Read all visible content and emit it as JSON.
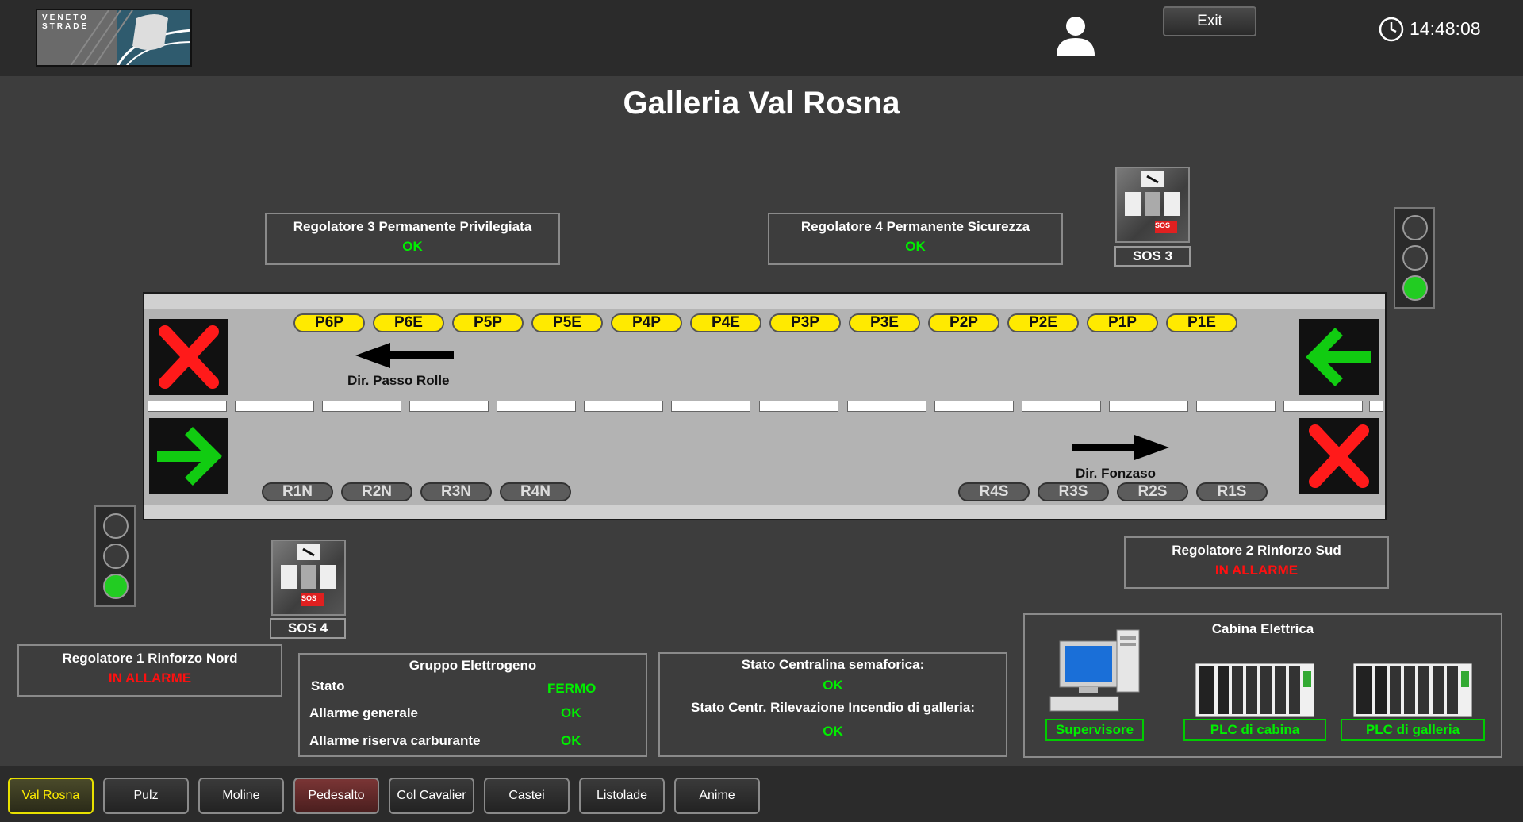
{
  "header": {
    "logo_text": "VENETO STRADE",
    "exit_label": "Exit",
    "time": "14:48:08"
  },
  "title": "Galleria Val Rosna",
  "regulators": {
    "r3": {
      "label": "Regolatore 3 Permanente Privilegiata",
      "status": "OK"
    },
    "r4": {
      "label": "Regolatore 4 Permanente Sicurezza",
      "status": "OK"
    },
    "r2": {
      "label": "Regolatore 2 Rinforzo Sud",
      "status": "IN ALLARME"
    },
    "r1": {
      "label": "Regolatore 1 Rinforzo Nord",
      "status": "IN ALLARME"
    }
  },
  "sos": {
    "sos3": "SOS 3",
    "sos4": "SOS 4",
    "badge": "SOS"
  },
  "tunnel": {
    "top_pills": [
      "P6P",
      "P6E",
      "P5P",
      "P5E",
      "P4P",
      "P4E",
      "P3P",
      "P3E",
      "P2P",
      "P2E",
      "P1P",
      "P1E"
    ],
    "bottom_left_pills": [
      "R1N",
      "R2N",
      "R3N",
      "R4N"
    ],
    "bottom_right_pills": [
      "R4S",
      "R3S",
      "R2S",
      "R1S"
    ],
    "dir_west": "Dir. Passo Rolle",
    "dir_east": "Dir. Fonzaso",
    "signals": {
      "top_left": "red-x",
      "top_right": "green-arrow-left",
      "bottom_left": "green-arrow-right",
      "bottom_right": "red-x"
    }
  },
  "traffic_lights": {
    "right": {
      "active_lamp": 3
    },
    "left": {
      "active_lamp": 3
    }
  },
  "generator": {
    "title": "Gruppo Elettrogeno",
    "rows": [
      {
        "label": "Stato",
        "value": "FERMO"
      },
      {
        "label": "Allarme generale",
        "value": "OK"
      },
      {
        "label": "Allarme riserva carburante",
        "value": "OK"
      }
    ]
  },
  "central": {
    "semaforica_label": "Stato Centralina semaforica:",
    "semaforica_value": "OK",
    "incendio_label": "Stato Centr. Rilevazione Incendio di galleria:",
    "incendio_value": "OK"
  },
  "cabina": {
    "title": "Cabina Elettrica",
    "supervisor": "Supervisore",
    "plc_cabina": "PLC di cabina",
    "plc_galleria": "PLC di galleria"
  },
  "nav": [
    "Val Rosna",
    "Pulz",
    "Moline",
    "Pedesalto",
    "Col Cavalier",
    "Castei",
    "Listolade",
    "Anime"
  ],
  "colors": {
    "ok": "#00ee00",
    "alarm": "#ff1010",
    "pill_yellow": "#ffea00",
    "lamp_on": "#22cc22"
  }
}
